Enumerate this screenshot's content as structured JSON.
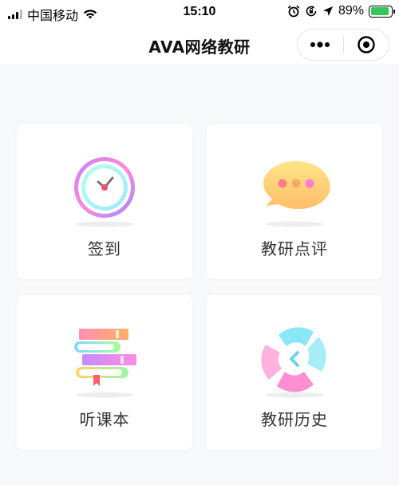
{
  "status_bar": {
    "carrier": "中国移动",
    "time": "15:10",
    "battery": "89%",
    "battery_level": 0.89,
    "icons": [
      "signal-icon",
      "wifi-icon",
      "alarm-icon",
      "orientation-lock-icon",
      "location-icon",
      "battery-icon"
    ]
  },
  "nav": {
    "title": "AVA网络教研",
    "menu_icon": "more-dots-icon",
    "close_icon": "target-circle-icon"
  },
  "grid": {
    "items": [
      {
        "label": "签到",
        "icon": "clock-icon"
      },
      {
        "label": "教研点评",
        "icon": "chat-bubble-icon"
      },
      {
        "label": "听课本",
        "icon": "books-icon"
      },
      {
        "label": "教研历史",
        "icon": "history-icon"
      }
    ]
  },
  "colors": {
    "background": "#f7f8fa",
    "card": "#ffffff",
    "text": "#333333"
  }
}
